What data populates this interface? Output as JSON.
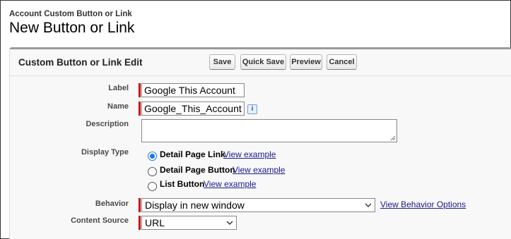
{
  "header": {
    "subtitle": "Account Custom Button or Link",
    "title": "New Button or Link"
  },
  "panel": {
    "title": "Custom Button or Link Edit",
    "buttons": {
      "save": "Save",
      "quick_save": "Quick Save",
      "preview": "Preview",
      "cancel": "Cancel"
    }
  },
  "form": {
    "label": {
      "label": "Label",
      "value": "Google This Account"
    },
    "name": {
      "label": "Name",
      "value": "Google_This_Account",
      "info_icon": "info-icon"
    },
    "description": {
      "label": "Description",
      "value": ""
    },
    "display_type": {
      "label": "Display Type",
      "options": [
        {
          "label": "Detail Page Link",
          "link": "View example",
          "checked": true
        },
        {
          "label": "Detail Page Button",
          "link": "View example",
          "checked": false
        },
        {
          "label": "List Button",
          "link": "View example",
          "checked": false
        }
      ]
    },
    "behavior": {
      "label": "Behavior",
      "value": "Display in new window",
      "link": "View Behavior Options"
    },
    "content_source": {
      "label": "Content Source",
      "value": "URL"
    }
  },
  "colors": {
    "required_marker": "#cc0000",
    "link": "#1a1a8c",
    "radio_selected": "#1a73e8"
  }
}
